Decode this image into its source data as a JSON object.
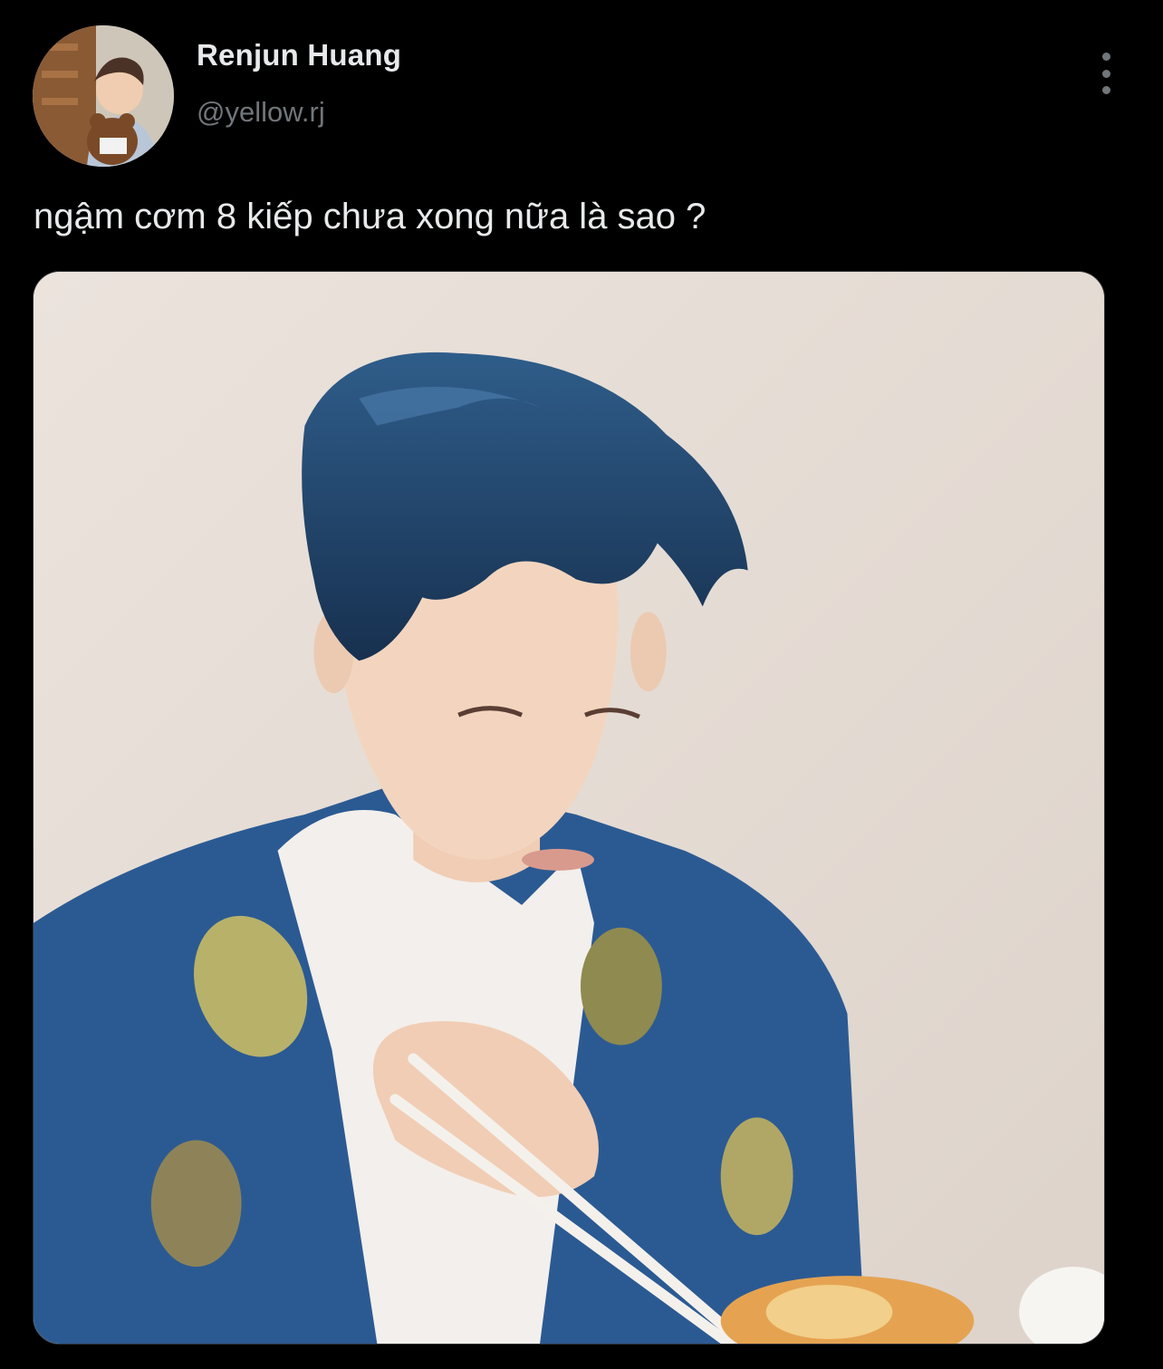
{
  "author": {
    "display_name": "Renjun Huang",
    "handle": "@yellow.rj",
    "avatar_icon": "profile-photo"
  },
  "tweet": {
    "text": "ngậm cơm 8 kiếp chưa xong nữa là sao ?"
  },
  "menu": {
    "icon": "more-vertical-icon"
  },
  "media": {
    "description_icon": "photo"
  },
  "colors": {
    "background": "#000000",
    "primary_text": "#e7e9ea",
    "secondary_text": "#71767b"
  }
}
